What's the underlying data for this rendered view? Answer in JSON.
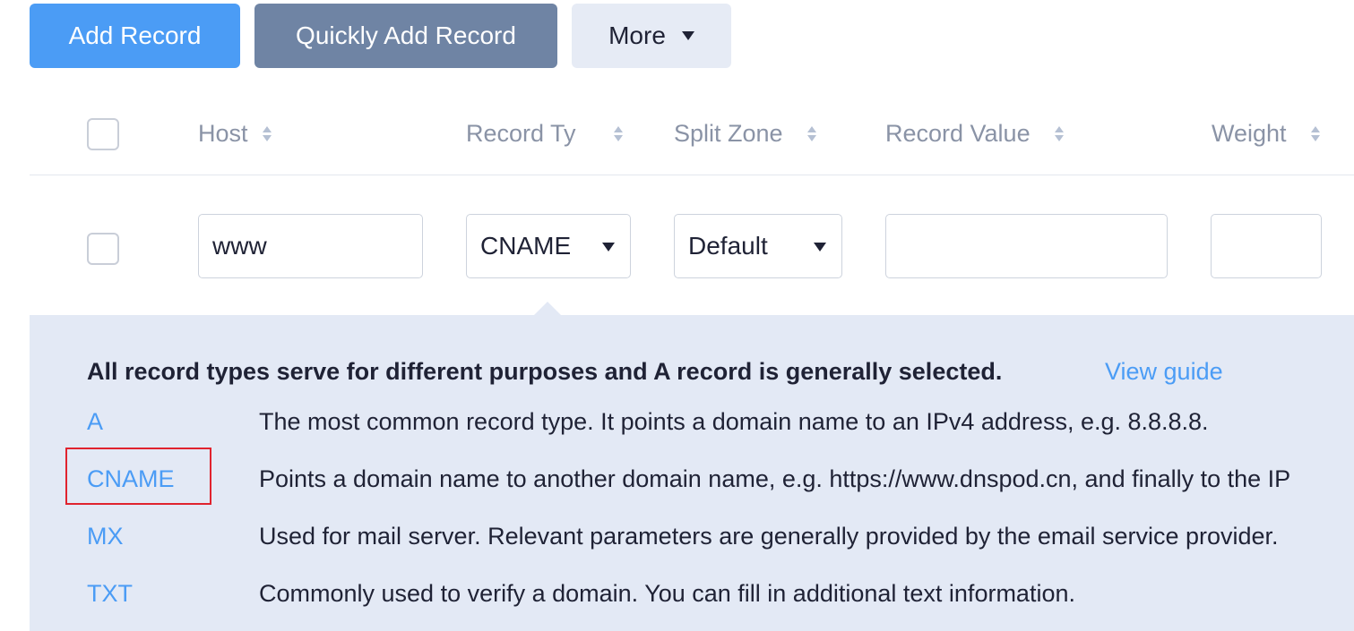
{
  "toolbar": {
    "add_record": "Add Record",
    "quick_add": "Quickly Add Record",
    "more": "More"
  },
  "columns": {
    "host": "Host",
    "record_type": "Record Ty",
    "split_zone": "Split Zone",
    "record_value": "Record Value",
    "weight": "Weight"
  },
  "edit_row": {
    "host": "www",
    "record_type": "CNAME",
    "split_zone": "Default",
    "record_value": "",
    "weight": ""
  },
  "help": {
    "heading": "All record types serve for different purposes and A record is generally selected.",
    "guide_link": "View guide",
    "types": [
      {
        "name": "A",
        "description": "The most common record type. It points a domain name to an IPv4 address, e.g. 8.8.8.8."
      },
      {
        "name": "CNAME",
        "description": "Points a domain name to another domain name, e.g. https://www.dnspod.cn, and finally to the IP"
      },
      {
        "name": "MX",
        "description": "Used for mail server. Relevant parameters are generally provided by the email service provider."
      },
      {
        "name": "TXT",
        "description": "Commonly used to verify a domain. You can fill in additional text information."
      }
    ]
  },
  "colors": {
    "primary": "#4b9cf5",
    "secondary": "#6f84a4",
    "panel": "#e3e9f5",
    "highlight": "#e0232e"
  }
}
